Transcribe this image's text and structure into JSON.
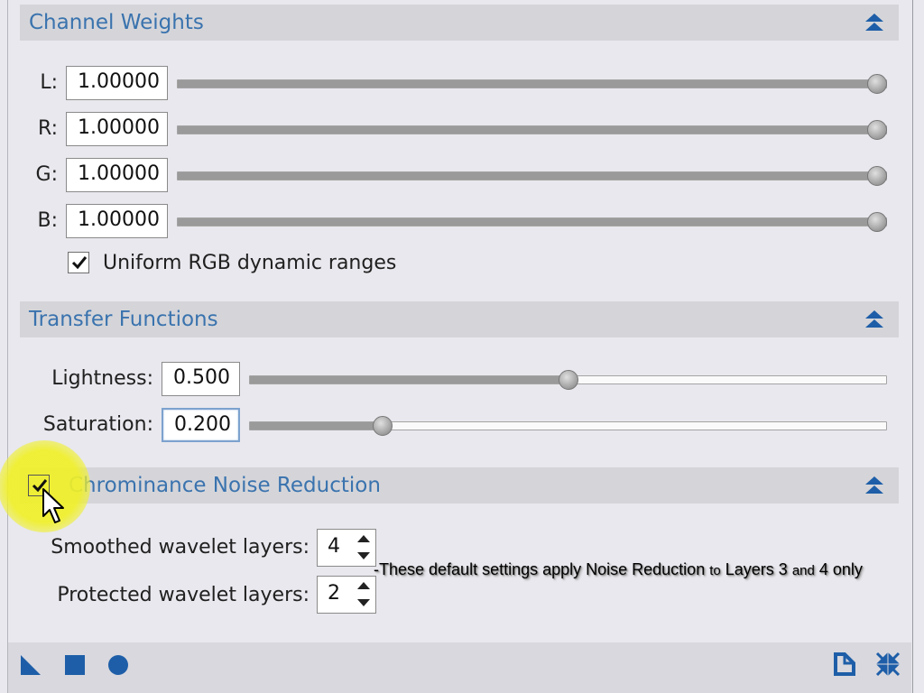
{
  "channel_weights": {
    "title": "Channel Weights",
    "rows": [
      {
        "label": "L:",
        "value": "1.00000",
        "level": 1.0
      },
      {
        "label": "R:",
        "value": "1.00000",
        "level": 1.0
      },
      {
        "label": "G:",
        "value": "1.00000",
        "level": 1.0
      },
      {
        "label": "B:",
        "value": "1.00000",
        "level": 1.0
      }
    ],
    "uniform_checkbox_label": "Uniform RGB dynamic ranges",
    "uniform_checked": true
  },
  "transfer_functions": {
    "title": "Transfer Functions",
    "lightness": {
      "label": "Lightness:",
      "value": "0.500",
      "level": 0.5
    },
    "saturation": {
      "label": "Saturation:",
      "value": "0.200",
      "level": 0.2
    }
  },
  "chrominance_noise_reduction": {
    "title": "Chrominance Noise Reduction",
    "enabled": true,
    "smoothed": {
      "label": "Smoothed wavelet layers:",
      "value": "4"
    },
    "protected": {
      "label": "Protected wavelet layers:",
      "value": "2"
    }
  },
  "annotation": {
    "part1": "-These default settings apply Noise Reduction",
    "part2": "to",
    "part3": "Layers 3",
    "part4": "and",
    "part5": "4 only"
  },
  "icons": {
    "collapse": "double-chevron-up-icon",
    "bottom_left": [
      "triangle-icon",
      "square-icon",
      "circle-icon"
    ],
    "bottom_right": [
      "document-icon",
      "reset-arrows-icon"
    ]
  },
  "colors": {
    "accent": "#3a73ae",
    "icon_blue": "#1e5ea8",
    "highlight": "#f0f028"
  }
}
